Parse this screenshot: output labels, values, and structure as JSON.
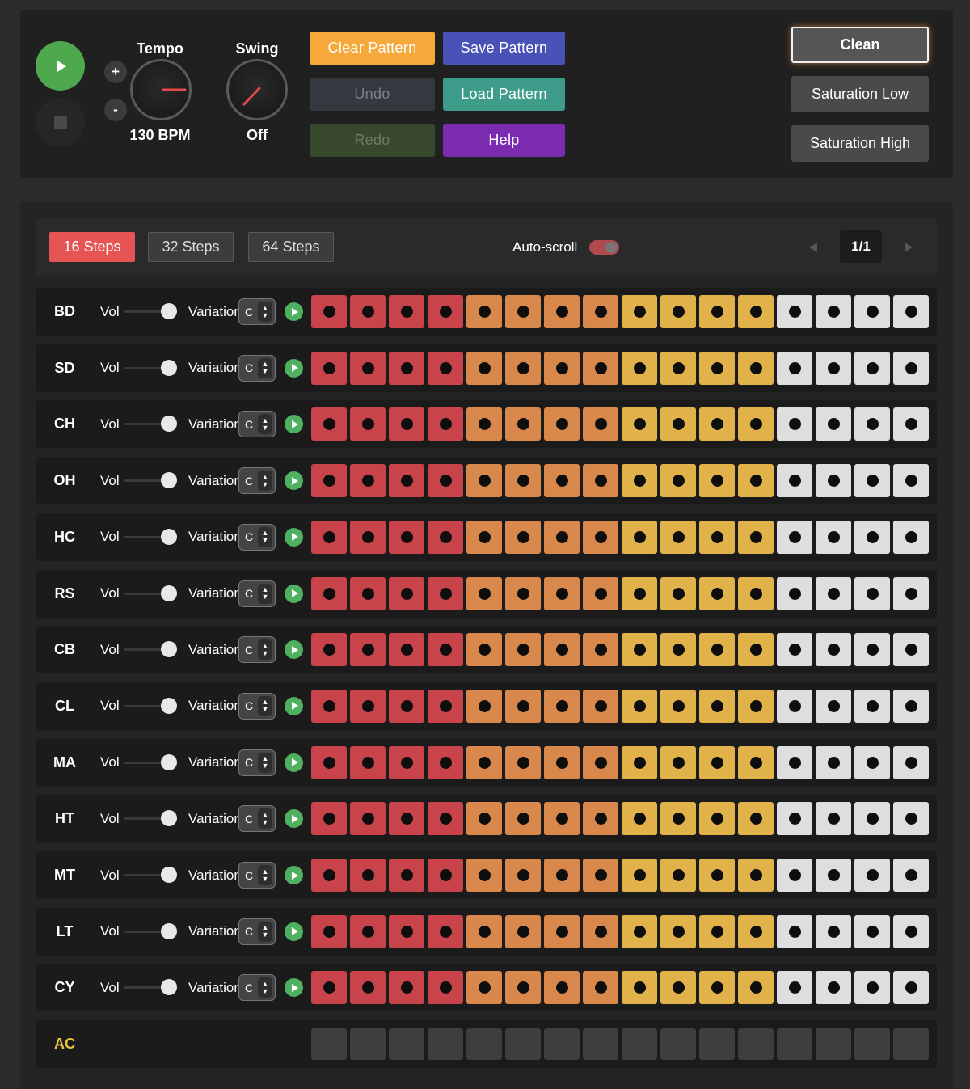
{
  "transport": {
    "play_icon": "play-icon",
    "stop_icon": "stop-icon"
  },
  "tempo": {
    "label": "Tempo",
    "value": "130 BPM",
    "inc": "+",
    "dec": "-"
  },
  "swing": {
    "label": "Swing",
    "value": "Off"
  },
  "actions": {
    "clear": "Clear Pattern",
    "save": "Save Pattern",
    "undo": "Undo",
    "load": "Load Pattern",
    "redo": "Redo",
    "help": "Help"
  },
  "saturation": {
    "clean": "Clean",
    "low": "Saturation Low",
    "high": "Saturation High",
    "selected": "Clean"
  },
  "steps": {
    "options": [
      "16 Steps",
      "32 Steps",
      "64 Steps"
    ],
    "selected": "16 Steps",
    "autoscroll_label": "Auto-scroll",
    "autoscroll_on": true,
    "page": "1/1",
    "prev_icon": "prev-icon",
    "next_icon": "next-icon"
  },
  "row_labels": {
    "vol": "Vol",
    "variation": "Variation",
    "variation_value": "C"
  },
  "tracks": [
    {
      "name": "BD",
      "volume": 1.0
    },
    {
      "name": "SD",
      "volume": 1.0
    },
    {
      "name": "CH",
      "volume": 1.0
    },
    {
      "name": "OH",
      "volume": 1.0
    },
    {
      "name": "HC",
      "volume": 1.0
    },
    {
      "name": "RS",
      "volume": 1.0
    },
    {
      "name": "CB",
      "volume": 1.0
    },
    {
      "name": "CL",
      "volume": 1.0
    },
    {
      "name": "MA",
      "volume": 1.0
    },
    {
      "name": "HT",
      "volume": 1.0
    },
    {
      "name": "MT",
      "volume": 1.0
    },
    {
      "name": "LT",
      "volume": 1.0
    },
    {
      "name": "CY",
      "volume": 1.0
    }
  ],
  "accent": {
    "name": "AC",
    "color": "#e8c640"
  },
  "colors": {
    "group1": "#c8434a",
    "group2": "#d9884c",
    "group3": "#e2b24a",
    "group4": "#dedede",
    "accent_step": "#3e3e3e",
    "active_tab": "#e65454",
    "play_green": "#4ea84e",
    "clear": "#f4a93a",
    "save": "#4a52b8",
    "undo": "#33393f",
    "load": "#3d9c8a",
    "redo": "#38482e",
    "help": "#7a2bb0"
  }
}
